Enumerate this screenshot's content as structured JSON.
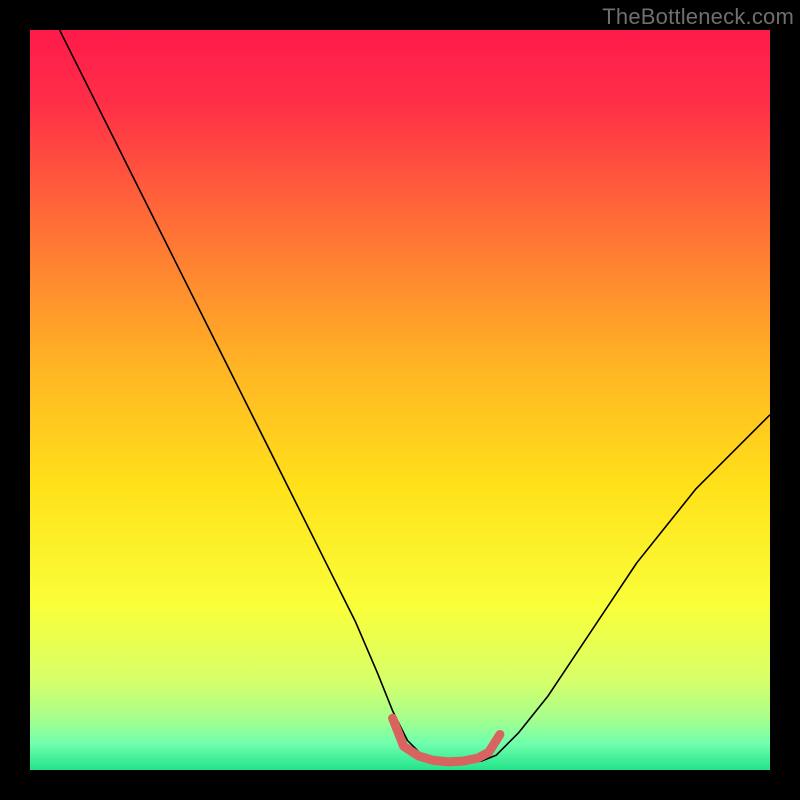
{
  "watermark": "TheBottleneck.com",
  "chart_data": {
    "type": "line",
    "title": "",
    "xlabel": "",
    "ylabel": "",
    "xlim": [
      0,
      100
    ],
    "ylim": [
      0,
      100
    ],
    "legend": false,
    "grid": false,
    "background_gradient_stops": [
      {
        "offset": 0.0,
        "color": "#ff1a4b"
      },
      {
        "offset": 0.1,
        "color": "#ff2f47"
      },
      {
        "offset": 0.25,
        "color": "#ff6a38"
      },
      {
        "offset": 0.45,
        "color": "#ffb324"
      },
      {
        "offset": 0.62,
        "color": "#ffe21a"
      },
      {
        "offset": 0.78,
        "color": "#f9ff3a"
      },
      {
        "offset": 0.88,
        "color": "#d6ff6a"
      },
      {
        "offset": 0.93,
        "color": "#a6ff8c"
      },
      {
        "offset": 0.965,
        "color": "#6fffad"
      },
      {
        "offset": 1.0,
        "color": "#22e38a"
      }
    ],
    "series": [
      {
        "name": "bottleneck-curve",
        "color": "#000000",
        "width": 1.6,
        "x": [
          4,
          8,
          12,
          16,
          20,
          24,
          28,
          32,
          36,
          40,
          44,
          47,
          49,
          51,
          53,
          55,
          57,
          59,
          61,
          63,
          66,
          70,
          74,
          78,
          82,
          86,
          90,
          94,
          98,
          100
        ],
        "y": [
          100,
          92,
          84,
          76,
          68,
          60,
          52,
          44,
          36,
          28,
          20,
          13,
          8,
          4,
          2,
          1.2,
          1.0,
          1.0,
          1.2,
          2,
          5,
          10,
          16,
          22,
          28,
          33,
          38,
          42,
          46,
          48
        ]
      },
      {
        "name": "optimal-zone-marker",
        "color": "#d9635f",
        "width": 9,
        "linecap": "round",
        "x": [
          49.0,
          50.5,
          52.5,
          54.5,
          56.5,
          58.5,
          60.5,
          62.0,
          63.5
        ],
        "y": [
          7.0,
          3.2,
          1.9,
          1.3,
          1.1,
          1.2,
          1.6,
          2.4,
          4.8
        ]
      }
    ]
  }
}
